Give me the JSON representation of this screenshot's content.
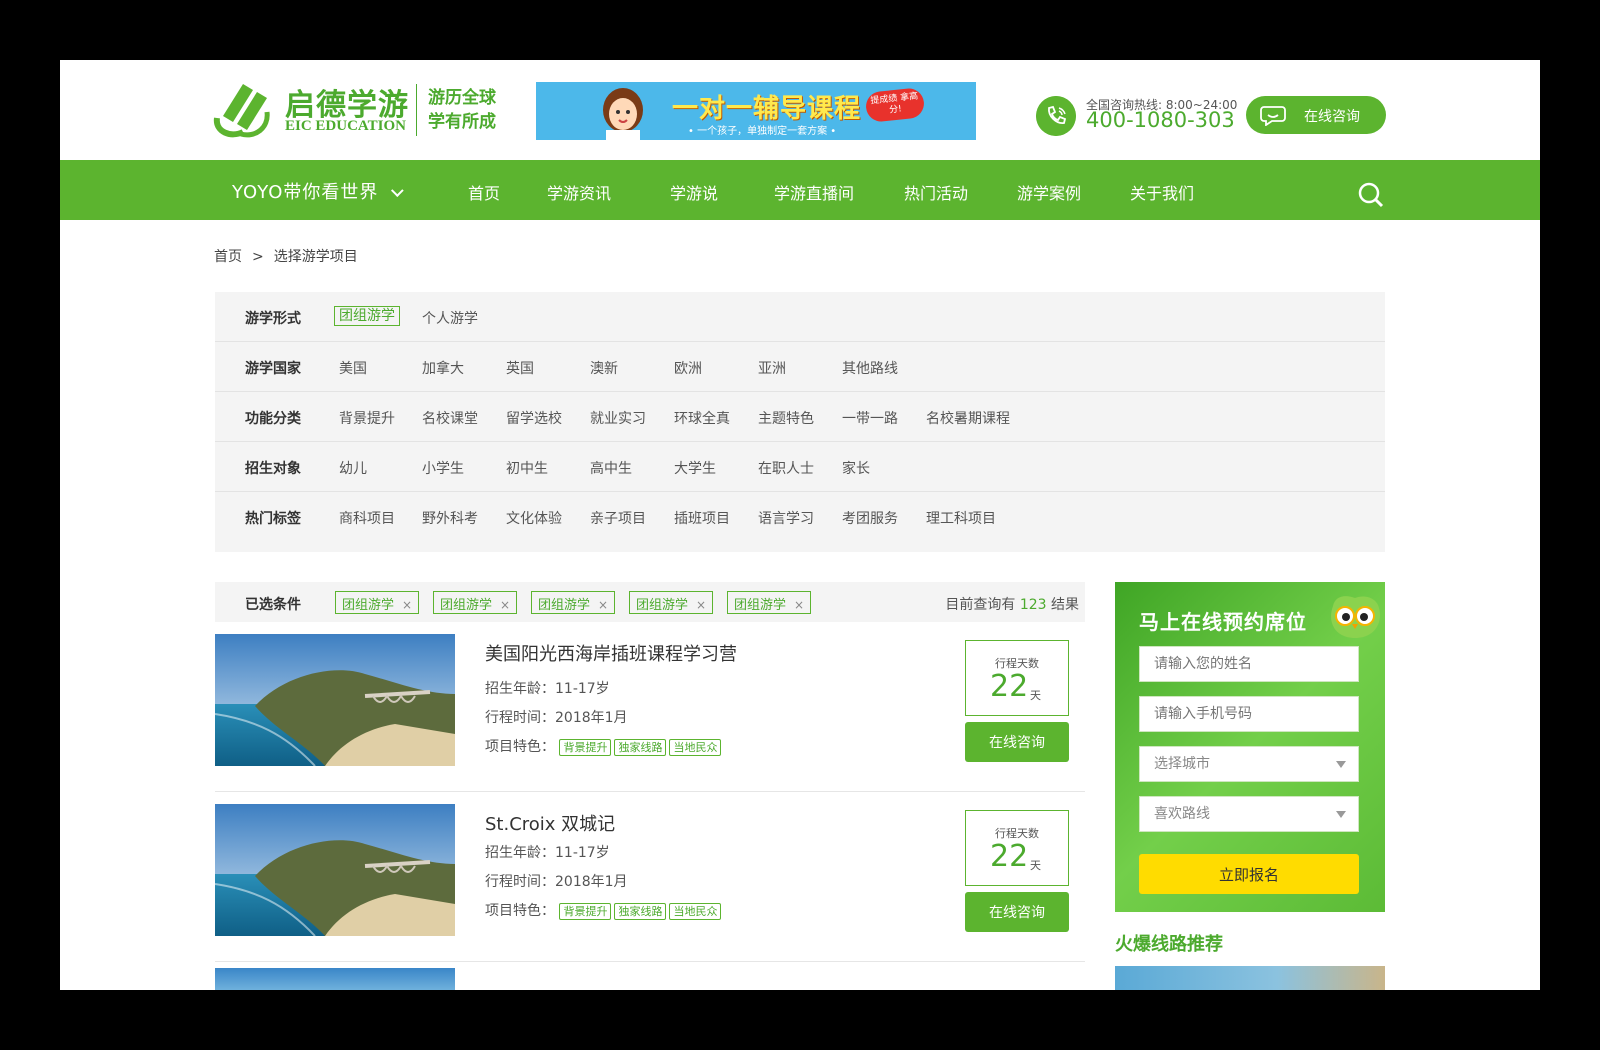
{
  "header": {
    "logo_cn": "启德学游",
    "logo_en": "EIC EDUCATION",
    "slogan_1": "游历全球",
    "slogan_2": "学有所成",
    "banner_title": "一对一辅导课程",
    "banner_sub": "• 一个孩子，单独制定一套方案 •",
    "banner_badge": "提成绩 拿高分!",
    "hotline_label": "全国咨询热线: 8:00~24:00",
    "hotline_number": "400-1080-303",
    "consult_label": "在线咨询"
  },
  "nav": {
    "brand": "YOYO带你看世界",
    "items": [
      "首页",
      "学游资讯",
      "学游说",
      "学游直播间",
      "热门活动",
      "游学案例",
      "关于我们"
    ]
  },
  "breadcrumb": {
    "home": "首页",
    "sep": ">",
    "current": "选择游学项目"
  },
  "filters": [
    {
      "label": "游学形式",
      "options": [
        "团组游学",
        "个人游学"
      ],
      "selected": 0
    },
    {
      "label": "游学国家",
      "options": [
        "美国",
        "加拿大",
        "英国",
        "澳新",
        "欧洲",
        "亚洲",
        "其他路线"
      ]
    },
    {
      "label": "功能分类",
      "options": [
        "背景提升",
        "名校课堂",
        "留学选校",
        "就业实习",
        "环球全真",
        "主题特色",
        "一带一路",
        "名校暑期课程"
      ]
    },
    {
      "label": "招生对象",
      "options": [
        "幼儿",
        "小学生",
        "初中生",
        "高中生",
        "大学生",
        "在职人士",
        "家长"
      ]
    },
    {
      "label": "热门标签",
      "options": [
        "商科项目",
        "野外科考",
        "文化体验",
        "亲子项目",
        "插班项目",
        "语言学习",
        "考团服务",
        "理工科项目"
      ]
    }
  ],
  "selected": {
    "label": "已选条件",
    "chips": [
      "团组游学",
      "团组游学",
      "团组游学",
      "团组游学",
      "团组游学"
    ],
    "remove_glyph": "×",
    "count_prefix": "目前查询有",
    "count": "123",
    "count_suffix": "结果"
  },
  "items": [
    {
      "title": "美国阳光西海岸插班课程学习营",
      "age": "招生年龄：11-17岁",
      "time": "行程时间：2018年1月",
      "feature_label": "项目特色：",
      "tags": [
        "背景提升",
        "独家线路",
        "当地民众"
      ],
      "days_label": "行程天数",
      "days": "22",
      "days_unit": "天",
      "button": "在线咨询"
    },
    {
      "title": "St.Croix 双城记",
      "age": "招生年龄：11-17岁",
      "time": "行程时间：2018年1月",
      "feature_label": "项目特色：",
      "tags": [
        "背景提升",
        "独家线路",
        "当地民众"
      ],
      "days_label": "行程天数",
      "days": "22",
      "days_unit": "天",
      "button": "在线咨询"
    }
  ],
  "side_form": {
    "title": "马上在线预约席位",
    "name_placeholder": "请输入您的姓名",
    "phone_placeholder": "请输入手机号码",
    "city_placeholder": "选择城市",
    "route_placeholder": "喜欢路线",
    "submit": "立即报名"
  },
  "hot": {
    "title": "火爆线路推荐"
  },
  "colors": {
    "brand_green": "#5cb42f",
    "accent_yellow": "#ffdc00"
  }
}
